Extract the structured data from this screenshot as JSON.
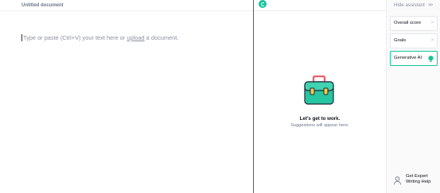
{
  "editor": {
    "document_title": "Untitled document",
    "placeholder_before": "Type or paste (Ctrl+V) your text here or ",
    "placeholder_link": "upload",
    "placeholder_after": " a document."
  },
  "assistant": {
    "empty_state_title": "Let's get to work.",
    "empty_state_subtitle": "Suggestions will appear here.",
    "illustration_icon": "briefcase-icon",
    "logo_icon": "grammarly-logo-icon"
  },
  "sidebar": {
    "hide_label": "Hide assistant",
    "hide_chevron": ">>",
    "cards": [
      {
        "label": "Overall score",
        "arrow": ">"
      },
      {
        "label": "Goals",
        "arrow": ">"
      },
      {
        "label": "Generative AI",
        "icon": "lightbulb-icon"
      }
    ],
    "expert_line1": "Get Expert",
    "expert_line2": "Writing Help",
    "expert_icon": "user-icon"
  },
  "colors": {
    "brand_green": "#15c39a",
    "briefcase_teal": "#26c6a0",
    "briefcase_handle": "#e8646e",
    "text_muted": "#8b90a0"
  }
}
